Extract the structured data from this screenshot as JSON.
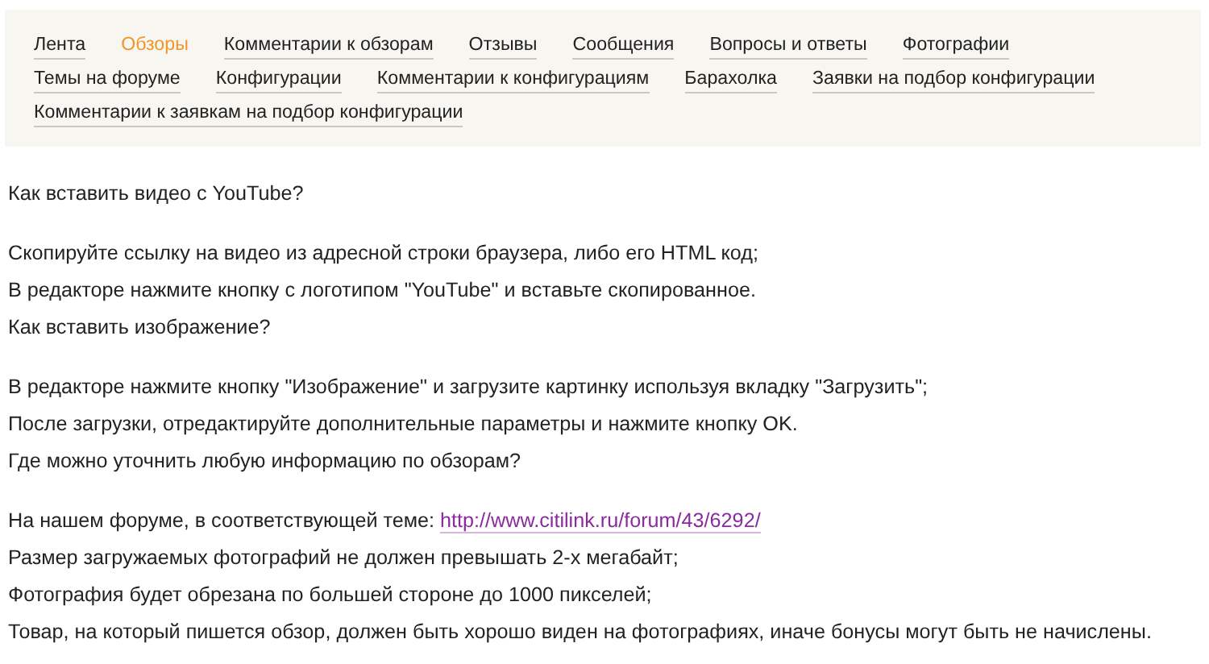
{
  "nav": [
    {
      "label": "Лента",
      "selected": false
    },
    {
      "label": "Обзоры",
      "selected": true
    },
    {
      "label": "Комментарии к обзорам",
      "selected": false
    },
    {
      "label": "Отзывы",
      "selected": false
    },
    {
      "label": "Сообщения",
      "selected": false
    },
    {
      "label": "Вопросы и ответы",
      "selected": false
    },
    {
      "label": "Фотографии",
      "selected": false
    },
    {
      "label": "Темы на форуме",
      "selected": false
    },
    {
      "label": "Конфигурации",
      "selected": false
    },
    {
      "label": "Комментарии к конфигурациям",
      "selected": false
    },
    {
      "label": "Барахолка",
      "selected": false
    },
    {
      "label": "Заявки на подбор конфигурации",
      "selected": false
    },
    {
      "label": "Комментарии к заявкам на подбор конфигурации",
      "selected": false
    }
  ],
  "faq": [
    {
      "question": "Как вставить видео с YouTube?",
      "answers": [
        {
          "text": "Скопируйте ссылку на видео из адресной строки браузера, либо его HTML код;"
        },
        {
          "text": "В редакторе нажмите кнопку с логотипом \"YouTube\" и вставьте скопированное."
        }
      ]
    },
    {
      "question": "Как вставить изображение?",
      "answers": [
        {
          "text": "В редакторе нажмите кнопку \"Изображение\" и загрузите картинку используя вкладку \"Загрузить\";"
        },
        {
          "text": "После загрузки, отредактируйте дополнительные параметры и нажмите кнопку OK."
        }
      ]
    },
    {
      "question": "Где можно уточнить любую информацию по обзорам?",
      "answers": [
        {
          "text": "На нашем форуме, в соответствующей теме:",
          "link": "http://www.citilink.ru/forum/43/6292/"
        },
        {
          "text": "Размер загружаемых фотографий не должен превышать 2-х мегабайт;"
        },
        {
          "text": "Фотография будет обрезана по большей стороне до 1000 пикселей;"
        },
        {
          "text": "Товар, на который пишется обзор, должен быть хорошо виден на фотографиях, иначе бонусы могут быть не начислены."
        }
      ]
    }
  ]
}
